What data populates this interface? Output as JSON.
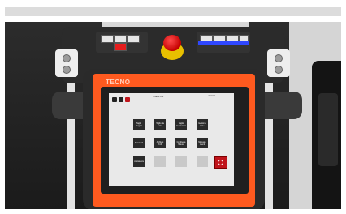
{
  "brand": "TECNO",
  "screen": {
    "title": "TSE 4.0.1",
    "version": "v1.0.0.0",
    "buttons": [
      {
        "label": "Taglio Singolo"
      },
      {
        "label": "Taglio da Lista"
      },
      {
        "label": "Taglio Automatico"
      },
      {
        "label": "Gestione Liste"
      },
      {
        "label": "Parametri"
      },
      {
        "label": "Archivio Profili"
      },
      {
        "label": "Cantilevra Misure"
      },
      {
        "label": "Manuale Utenti"
      },
      {
        "label": "Assistenza"
      }
    ],
    "power_icon": "power-icon"
  },
  "colors": {
    "accent": "#ff5a1f",
    "estop": "#d61010",
    "blue_indicator": "#2f47ff"
  }
}
